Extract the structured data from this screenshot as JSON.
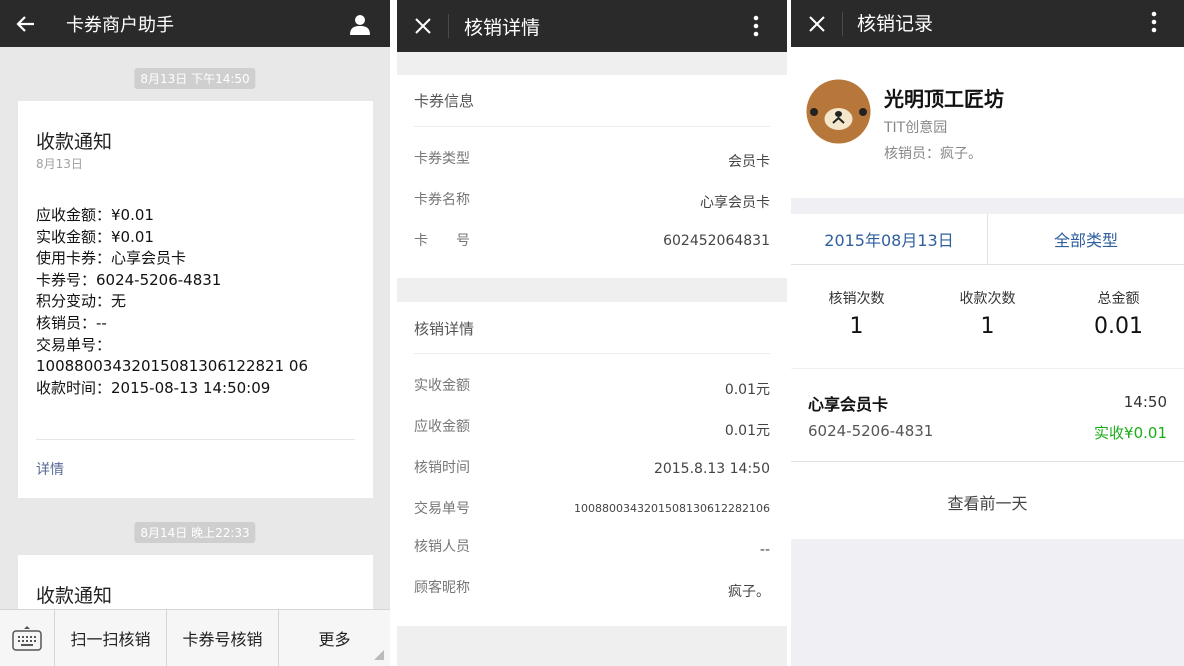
{
  "panel1": {
    "title": "卡券商户助手",
    "messages": [
      {
        "time": "8月13日 下午14:50",
        "title": "收款通知",
        "date": "8月13日",
        "lines": [
          "应收金额：¥0.01",
          "实收金额：¥0.01",
          "使用卡券：心享会员卡",
          "卡券号：6024-5206-4831",
          "积分变动：无",
          "核销员：--",
          "交易单号：",
          "10088003432015081306122821 06",
          "收款时间：2015-08-13 14:50:09"
        ],
        "link": "详情"
      },
      {
        "time": "8月14日 晚上22:33",
        "title": "收款通知"
      }
    ],
    "bottom_buttons": [
      "扫一扫核销",
      "卡券号核销",
      "更多"
    ]
  },
  "panel2": {
    "title": "核销详情",
    "section1": {
      "heading": "卡券信息",
      "rows": [
        {
          "label": "卡券类型",
          "value": "会员卡"
        },
        {
          "label": "卡券名称",
          "value": "心享会员卡"
        },
        {
          "label": "卡　　号",
          "value": "602452064831"
        }
      ]
    },
    "section2": {
      "heading": "核销详情",
      "rows": [
        {
          "label": "实收金额",
          "value": "0.01元"
        },
        {
          "label": "应收金额",
          "value": "0.01元"
        },
        {
          "label": "核销时间",
          "value": "2015.8.13 14:50"
        },
        {
          "label": "交易单号",
          "value": "1008800343201508130612282106"
        },
        {
          "label": "核销人员",
          "value": "--"
        },
        {
          "label": "顾客昵称",
          "value": "疯子。"
        }
      ]
    }
  },
  "panel3": {
    "title": "核销记录",
    "merchant": {
      "name": "光明顶工匠坊",
      "branch": "TIT创意园",
      "operator": "核销员：疯子。"
    },
    "filters": {
      "date": "2015年08月13日",
      "type": "全部类型"
    },
    "stats": [
      {
        "label": "核销次数",
        "value": "1"
      },
      {
        "label": "收款次数",
        "value": "1"
      },
      {
        "label": "总金额",
        "value": "0.01"
      }
    ],
    "record": {
      "name": "心享会员卡",
      "time": "14:50",
      "card_no": "6024-5206-4831",
      "amount": "实收¥0.01"
    },
    "prev_day": "查看前一天"
  },
  "colors": {
    "topbar": "#2a2a2a",
    "link": "#576b95",
    "filter_text": "#2f5f9e",
    "amount_green": "#1aad19",
    "avatar_brown": "#b8773a"
  }
}
